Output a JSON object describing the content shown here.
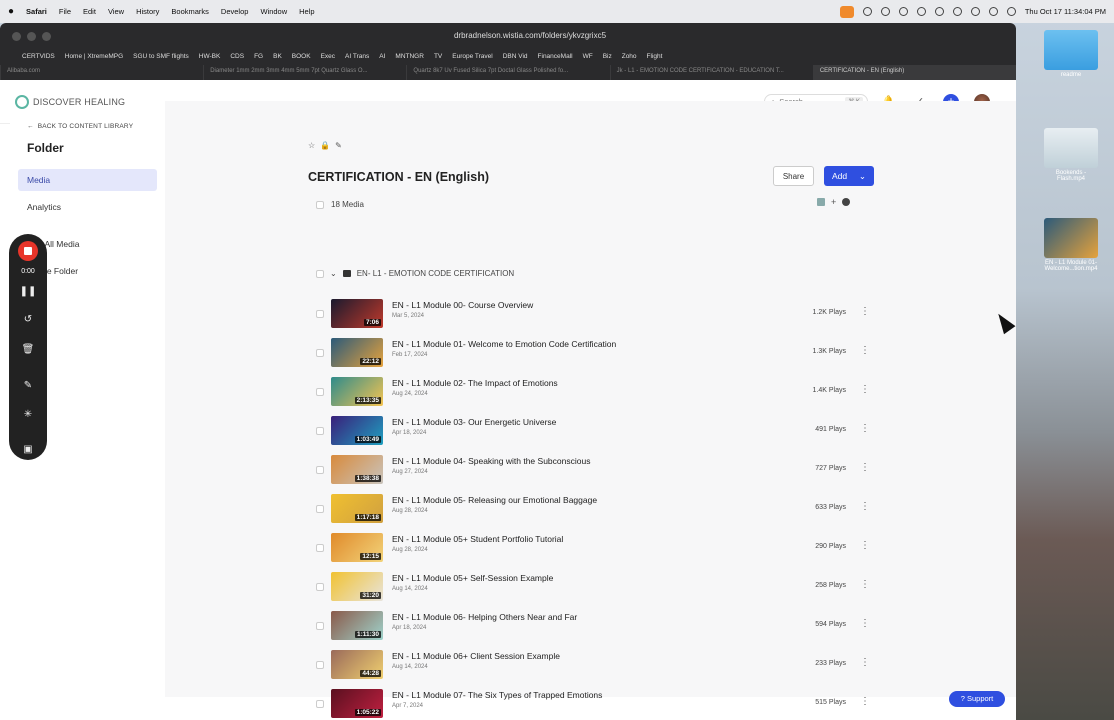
{
  "menubar": {
    "apple": "",
    "items": [
      "Safari",
      "File",
      "Edit",
      "View",
      "History",
      "Bookmarks",
      "Develop",
      "Window",
      "Help"
    ],
    "clock": "Thu Oct 17  11:34:04 PM"
  },
  "browser": {
    "url": "drbradnelson.wistia.com/folders/ykvzgrixc5",
    "bookmarks": [
      "CERTVIDS",
      "Home | XtremeMPG",
      "SGU to SMF flights",
      "HW-BK",
      "CDS",
      "FG",
      "BK",
      "BOOK",
      "Exec",
      "AI Trans",
      "AI",
      "MNTNGR",
      "TV",
      "Europe Travel",
      "DBN Vid",
      "FinanceMall",
      "WF",
      "Biz",
      "Zoho",
      "Flight"
    ],
    "tabs": [
      "Alibaba.com",
      "Diameter 1mm 2mm 3mm 4mm 5mm 7pt Quartz Glass O...",
      "Quartz 8k7 Uv Fused Silica 7pt Doctal Glass Polished fo...",
      "Jk - L1 - EMOTION CODE CERTIFICATION - EDUCATION T...",
      "CERTIFICATION - EN (English)"
    ]
  },
  "app": {
    "logo": "DISCOVER HEALING",
    "search_placeholder": "Search",
    "search_kbd": "⌘ K"
  },
  "sidebar": {
    "back": "BACK TO CONTENT LIBRARY",
    "heading": "Folder",
    "items": [
      "Media",
      "Analytics",
      "Sort All Media",
      "Delete Folder"
    ]
  },
  "recorder": {
    "time": "0:00"
  },
  "main": {
    "title": "CERTIFICATION - EN (English)",
    "share": "Share",
    "add": "Add",
    "count": "18 Media",
    "group": "EN- L1 - EMOTION CODE CERTIFICATION",
    "rows": [
      {
        "title": "EN - L1 Module 00- Course Overview",
        "date": "Mar 5, 2024",
        "dur": "7:06",
        "plays": "1.2K Plays",
        "c1": "#1a1a2e",
        "c2": "#c0392b"
      },
      {
        "title": "EN - L1 Module 01- Welcome to Emotion Code Certification",
        "date": "Feb 17, 2024",
        "dur": "22:12",
        "plays": "1.3K Plays",
        "c1": "#2b5a7a",
        "c2": "#e6a23c"
      },
      {
        "title": "EN - L1 Module 02- The Impact of Emotions",
        "date": "Aug 24, 2024",
        "dur": "2:13:35",
        "plays": "1.4K Plays",
        "c1": "#2e8b8b",
        "c2": "#f5c451"
      },
      {
        "title": "EN - L1 Module 03- Our Energetic Universe",
        "date": "Apr 18, 2024",
        "dur": "1:03:49",
        "plays": "491 Plays",
        "c1": "#3a1f7a",
        "c2": "#1fa0c0"
      },
      {
        "title": "EN - L1 Module 04- Speaking with the Subconscious",
        "date": "Aug 27, 2024",
        "dur": "1:38:38",
        "plays": "727 Plays",
        "c1": "#d88a3c",
        "c2": "#c9c4bd"
      },
      {
        "title": "EN - L1 Module 05- Releasing our Emotional Baggage",
        "date": "Aug 28, 2024",
        "dur": "1:17:18",
        "plays": "633 Plays",
        "c1": "#f0c030",
        "c2": "#d0a040"
      },
      {
        "title": "EN - L1 Module 05+ Student Portfolio Tutorial",
        "date": "Aug 28, 2024",
        "dur": "12:15",
        "plays": "290 Plays",
        "c1": "#e08a2a",
        "c2": "#f2d37a"
      },
      {
        "title": "EN - L1 Module 05+ Self-Session Example",
        "date": "Aug 14, 2024",
        "dur": "31:20",
        "plays": "258 Plays",
        "c1": "#f1c232",
        "c2": "#e8e4dc"
      },
      {
        "title": "EN - L1 Module 06- Helping Others Near and Far",
        "date": "Apr 18, 2024",
        "dur": "1:11:30",
        "plays": "594 Plays",
        "c1": "#8a5a4a",
        "c2": "#9fd3cc"
      },
      {
        "title": "EN - L1 Module 06+ Client Session Example",
        "date": "Aug 14, 2024",
        "dur": "44:28",
        "plays": "233 Plays",
        "c1": "#9a6a5a",
        "c2": "#f0d070"
      },
      {
        "title": "EN - L1 Module 07- The Six Types of Trapped Emotions",
        "date": "Apr 7, 2024",
        "dur": "1:05:22",
        "plays": "515 Plays",
        "c1": "#5a1020",
        "c2": "#c02040"
      }
    ]
  },
  "support": "Support",
  "desktop": [
    {
      "label": "readme",
      "c1": "#3a9ee0",
      "c2": "#6cc0f0"
    },
    {
      "label": "Bookends - Flash.mp4",
      "c1": "#e8eef2",
      "c2": "#c0d0d8"
    },
    {
      "label": "EN - L1 Module 01- Welcome...tion.mp4",
      "c1": "#2b5a7a",
      "c2": "#e6a23c"
    }
  ],
  "colors": {
    "accent": "#2f4fe0",
    "record": "#e8352a"
  }
}
